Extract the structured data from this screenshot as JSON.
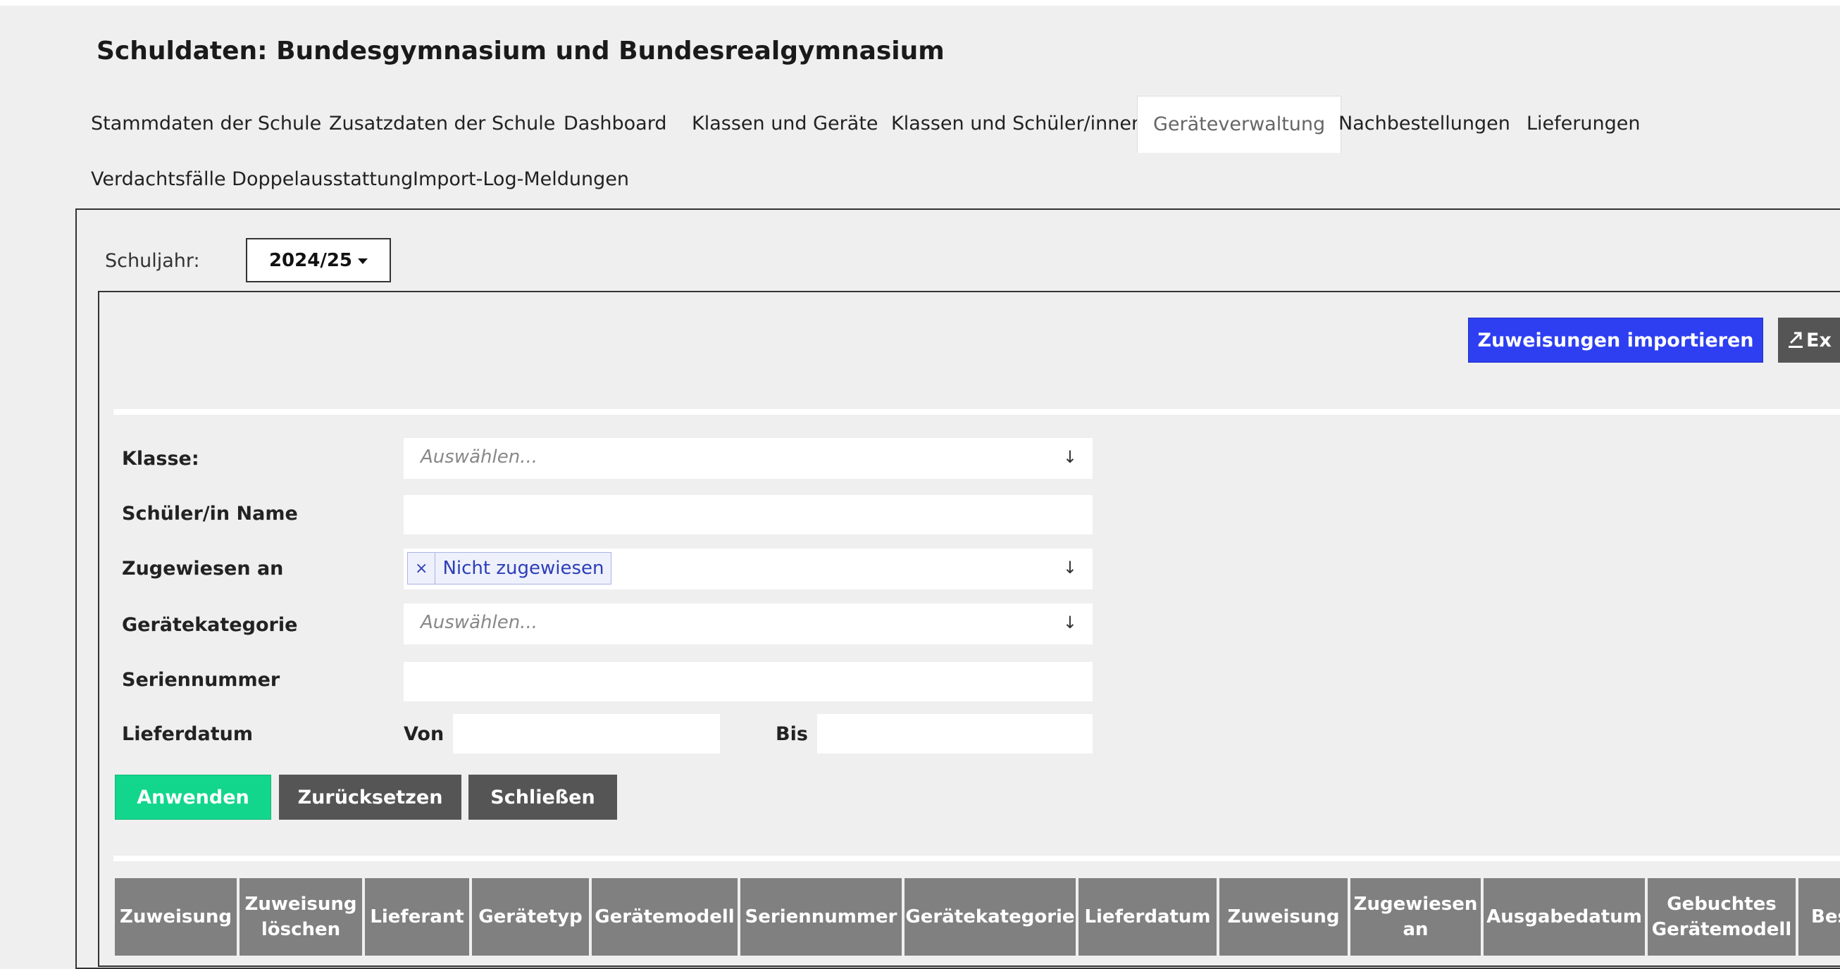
{
  "page_title": "Schuldaten: Bundesgymnasium und Bundesrealgymnasium",
  "tabs": [
    {
      "label": "Stammdaten der Schule"
    },
    {
      "label": "Zusatzdaten der Schule"
    },
    {
      "label": "Dashboard"
    },
    {
      "label": "Klassen und Geräte"
    },
    {
      "label": "Klassen und Schüler/innen"
    },
    {
      "label": "Geräteverwaltung",
      "active": true
    },
    {
      "label": "Nachbestellungen"
    },
    {
      "label": "Lieferungen"
    },
    {
      "label": "Verdachtsfälle Doppelausstattung"
    },
    {
      "label": "Import-Log-Meldungen"
    }
  ],
  "schuljahr": {
    "label": "Schuljahr:",
    "value": "2024/25"
  },
  "actions": {
    "import_label": "Zuweisungen importieren",
    "export_label": "Ex"
  },
  "filters": {
    "klasse": {
      "label": "Klasse:",
      "placeholder": "Auswählen..."
    },
    "schueler": {
      "label": "Schüler/in Name",
      "value": ""
    },
    "zugewiesen": {
      "label": "Zugewiesen an",
      "tag": "Nicht zugewiesen",
      "tag_remove": "×"
    },
    "kategorie": {
      "label": "Gerätekategorie",
      "placeholder": "Auswählen..."
    },
    "seriennummer": {
      "label": "Seriennummer",
      "value": ""
    },
    "lieferdatum": {
      "label": "Lieferdatum",
      "von_label": "Von",
      "bis_label": "Bis",
      "von": "",
      "bis": ""
    },
    "select_arrow": "↓"
  },
  "filter_buttons": {
    "apply": "Anwenden",
    "reset": "Zurücksetzen",
    "close": "Schließen"
  },
  "table": {
    "headers": [
      "Zuweisung",
      "Zuweisung\nlöschen",
      "Lieferant",
      "Gerätetyp",
      "Gerätemodell",
      "Seriennummer",
      "Gerätekategorie",
      "Lieferdatum",
      "Zuweisung",
      "Zugewiesen\nan",
      "Ausgabedatum",
      "Gebuchtes\nGerätemodell",
      "Bes"
    ]
  },
  "colors": {
    "primary": "#2d3ff0",
    "success": "#12d68c",
    "neutral": "#555555",
    "table_header": "#808080"
  }
}
